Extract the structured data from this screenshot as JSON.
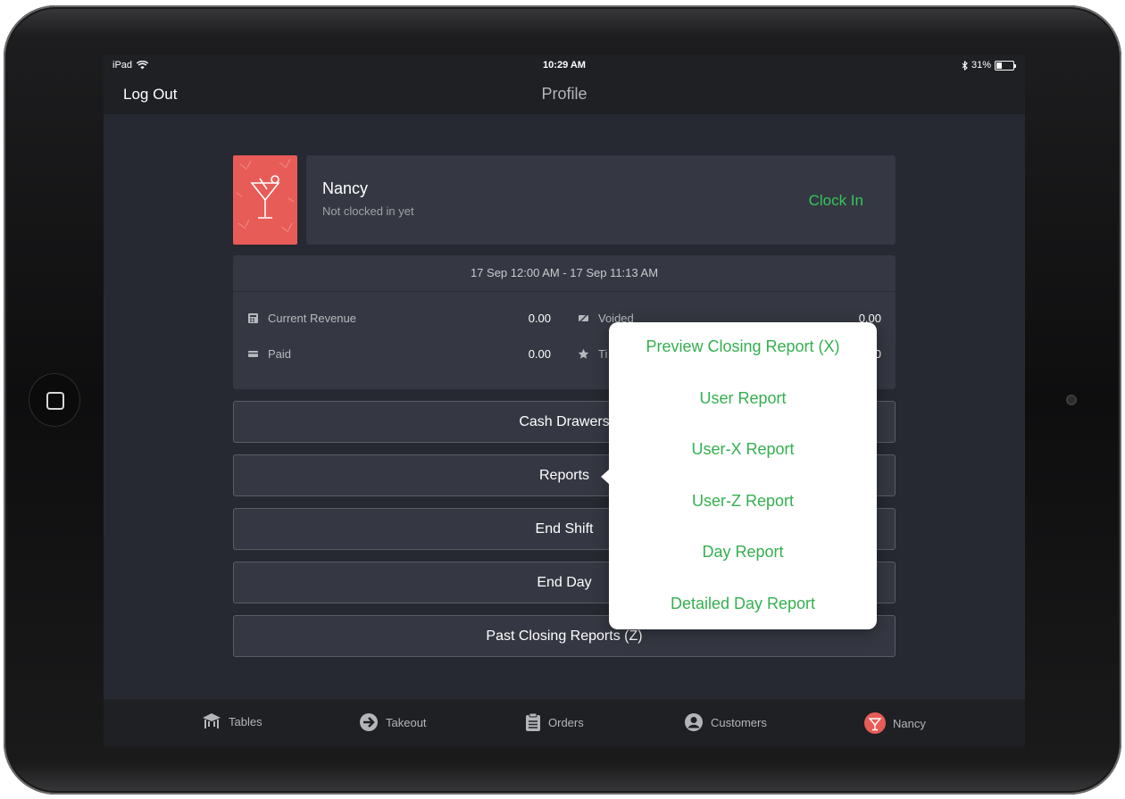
{
  "device": {
    "status_bar": {
      "carrier": "iPad",
      "time": "10:29 AM",
      "battery": "31%"
    }
  },
  "navbar": {
    "left_button": "Log Out",
    "title": "Profile"
  },
  "profile": {
    "name": "Nancy",
    "status": "Not clocked in yet",
    "clock_in_label": "Clock In",
    "avatar_color": "#e85c58"
  },
  "stats": {
    "range": "17 Sep 12:00 AM - 17 Sep 11:13 AM",
    "rows": [
      {
        "icon": "register-icon",
        "label": "Current Revenue",
        "value": "0.00"
      },
      {
        "icon": "card-icon",
        "label": "Paid",
        "value": "0.00"
      },
      {
        "icon": "voided-icon",
        "label": "Voided",
        "value": "0.00"
      },
      {
        "icon": "star-icon",
        "label": "Ti",
        "value": "0"
      }
    ]
  },
  "menu": {
    "cash_drawers": "Cash Drawers",
    "reports": "Reports",
    "end_shift": "End Shift",
    "end_day": "End Day",
    "past_closing": "Past Closing Reports (Z)"
  },
  "reports_popover": {
    "items": [
      "Preview Closing Report (X)",
      "User Report",
      "User-X Report",
      "User-Z Report",
      "Day Report",
      "Detailed Day Report"
    ]
  },
  "tabbar": {
    "items": [
      {
        "label": "Tables",
        "icon": "tables-icon"
      },
      {
        "label": "Takeout",
        "icon": "takeout-icon"
      },
      {
        "label": "Orders",
        "icon": "orders-icon"
      },
      {
        "label": "Customers",
        "icon": "customers-icon"
      },
      {
        "label": "Nancy",
        "icon": "cocktail-avatar-icon"
      }
    ]
  },
  "colors": {
    "accent_green": "#34c75a",
    "background": "#262931",
    "card": "#353842"
  }
}
